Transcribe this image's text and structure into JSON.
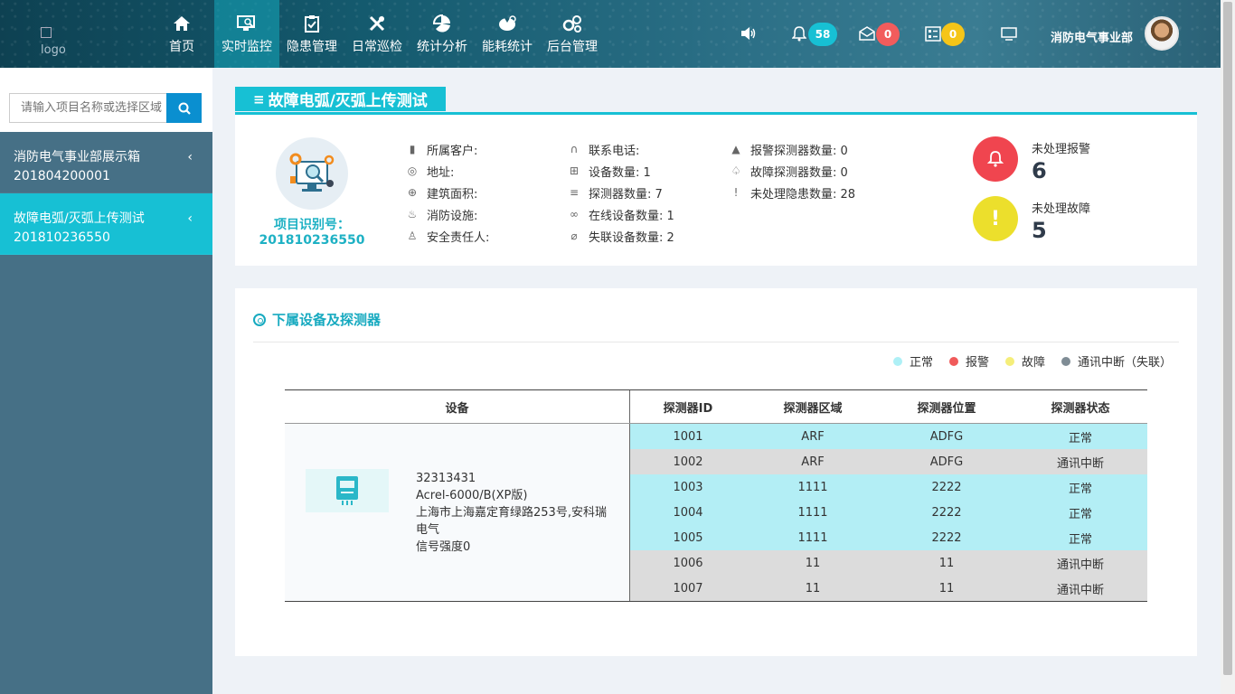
{
  "header": {
    "logo_alt": "logo",
    "nav": [
      {
        "label": "首页",
        "icon": "home-icon"
      },
      {
        "label": "实时监控",
        "icon": "monitor-search-icon"
      },
      {
        "label": "隐患管理",
        "icon": "clipboard-icon"
      },
      {
        "label": "日常巡检",
        "icon": "tools-icon"
      },
      {
        "label": "统计分析",
        "icon": "chart-fan-icon"
      },
      {
        "label": "能耗统计",
        "icon": "energy-icon"
      },
      {
        "label": "后台管理",
        "icon": "gears-icon"
      }
    ],
    "active_nav": "实时监控",
    "alarm_count": "58",
    "mail_count": "0",
    "task_count": "0",
    "user_name": "消防电气事业部"
  },
  "sidebar": {
    "search_placeholder": "请输入项目名称或选择区域",
    "items": [
      {
        "name": "消防电气事业部展示箱",
        "code": "201804200001",
        "active": false
      },
      {
        "name": "故障电弧/灭弧上传测试",
        "code": "201810236550",
        "active": true
      }
    ]
  },
  "project": {
    "title": "故障电弧/灭弧上传测试",
    "id_label": "项目识别号：",
    "id_value": "201810236550",
    "col1": [
      {
        "icon": "user-card-icon",
        "text": "所属客户:"
      },
      {
        "icon": "location-icon",
        "text": "地址:"
      },
      {
        "icon": "building-icon",
        "text": "建筑面积:"
      },
      {
        "icon": "fire-icon",
        "text": "消防设施:"
      },
      {
        "icon": "person-icon",
        "text": "安全责任人:"
      }
    ],
    "col2": [
      {
        "icon": "headset-icon",
        "text": "联系电话:"
      },
      {
        "icon": "grid-icon",
        "text": "设备数量: 1"
      },
      {
        "icon": "sliders-icon",
        "text": "探测器数量: 7"
      },
      {
        "icon": "link-icon",
        "text": "在线设备数量: 1"
      },
      {
        "icon": "unlink-icon",
        "text": "失联设备数量: 2"
      }
    ],
    "col3": [
      {
        "icon": "warning-icon",
        "text": "报警探测器数量: 0"
      },
      {
        "icon": "bell-outline-icon",
        "text": "故障探测器数量: 0"
      },
      {
        "icon": "exclamation-icon",
        "text": "未处理隐患数量: 28"
      }
    ],
    "unhandled_alarm_label": "未处理报警",
    "unhandled_alarm_value": "6",
    "unhandled_fault_label": "未处理故障",
    "unhandled_fault_value": "5"
  },
  "devices": {
    "title": "下属设备及探测器",
    "legend": [
      {
        "label": "正常",
        "color": "#aef0f6"
      },
      {
        "label": "报警",
        "color": "#f05a5a"
      },
      {
        "label": "故障",
        "color": "#f5ee7a"
      },
      {
        "label": "通讯中断（失联）",
        "color": "#7f8c95"
      }
    ],
    "headers": {
      "device": "设备",
      "id": "探测器ID",
      "area": "探测器区域",
      "position": "探测器位置",
      "status": "探测器状态"
    },
    "device": {
      "serial": "32313431",
      "model": "Acrel-6000/B(XP版)",
      "address": "上海市上海嘉定育绿路253号,安科瑞电气",
      "signal": "信号强度0"
    },
    "detectors": [
      {
        "id": "1001",
        "area": "ARF",
        "position": "ADFG",
        "status": "正常",
        "state": "normal"
      },
      {
        "id": "1002",
        "area": "ARF",
        "position": "ADFG",
        "status": "通讯中断",
        "state": "offline"
      },
      {
        "id": "1003",
        "area": "1111",
        "position": "2222",
        "status": "正常",
        "state": "normal"
      },
      {
        "id": "1004",
        "area": "1111",
        "position": "2222",
        "status": "正常",
        "state": "normal"
      },
      {
        "id": "1005",
        "area": "1111",
        "position": "2222",
        "status": "正常",
        "state": "normal"
      },
      {
        "id": "1006",
        "area": "11",
        "position": "11",
        "status": "通讯中断",
        "state": "offline"
      },
      {
        "id": "1007",
        "area": "11",
        "position": "11",
        "status": "通讯中断",
        "state": "offline"
      }
    ]
  }
}
